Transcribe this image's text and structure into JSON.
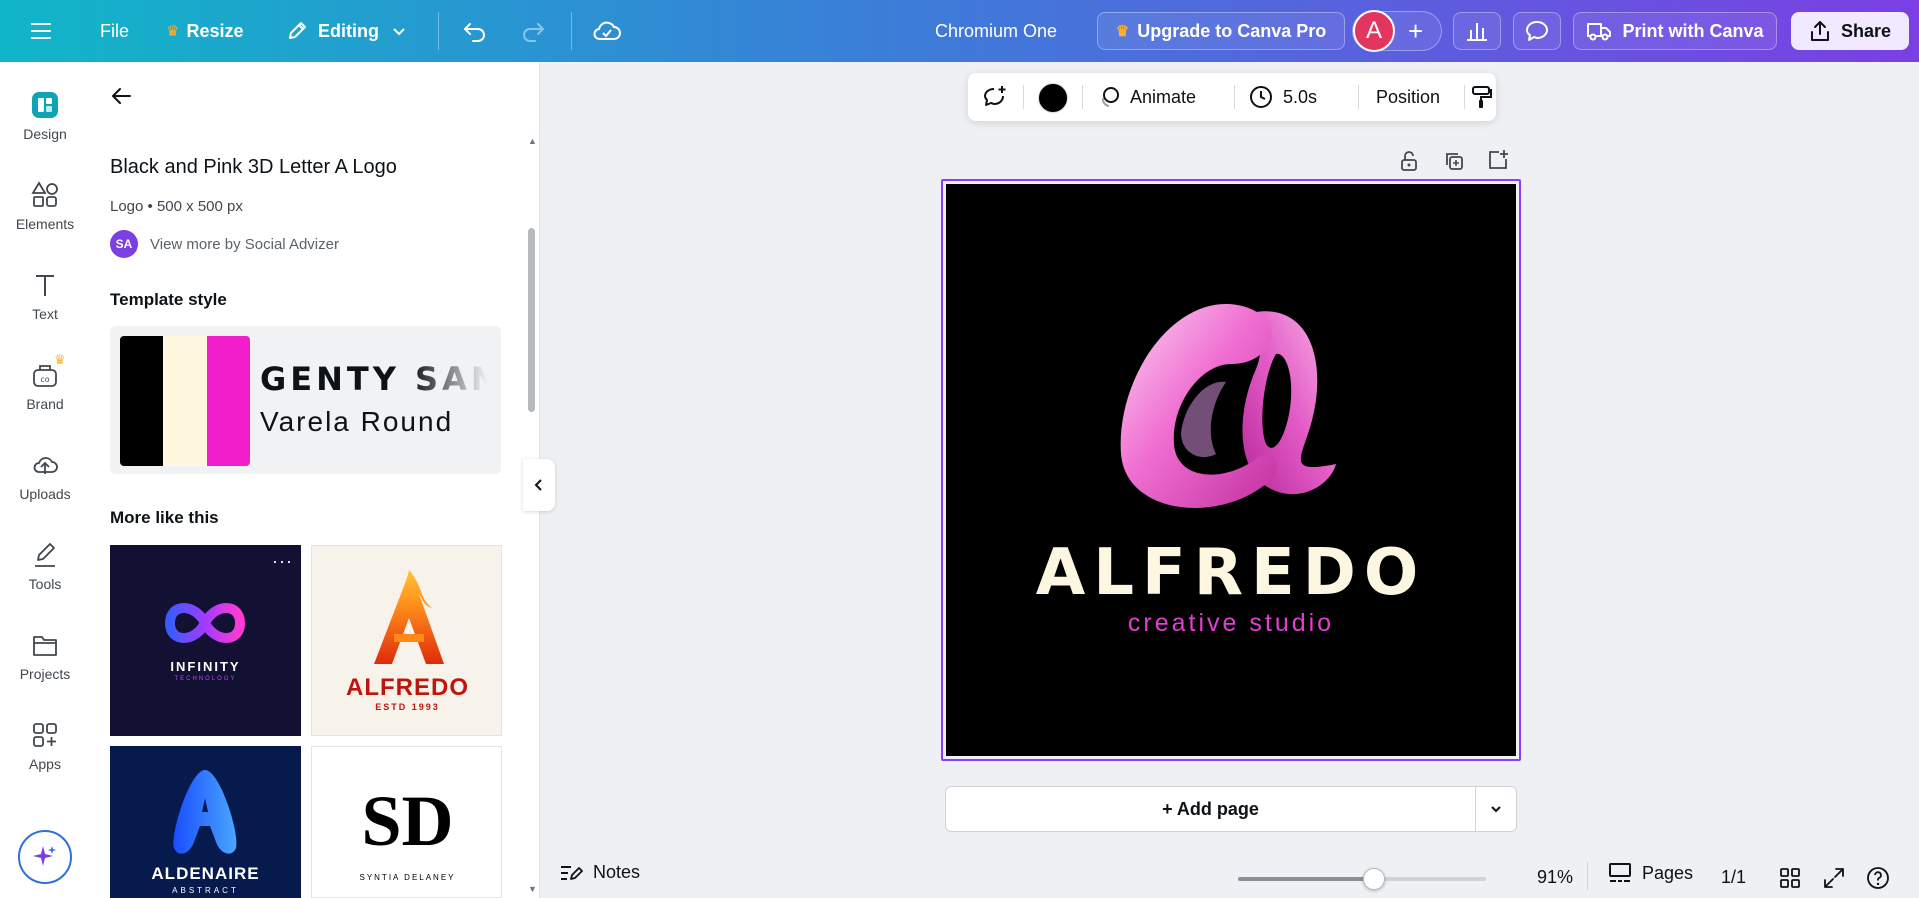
{
  "topbar": {
    "file": "File",
    "resize": "Resize",
    "editing": "Editing",
    "doc_title": "Chromium One",
    "upgrade": "Upgrade to Canva Pro",
    "avatar_initial": "A",
    "print": "Print with Canva",
    "share": "Share"
  },
  "rail": {
    "items": [
      {
        "label": "Design",
        "icon": "design-icon"
      },
      {
        "label": "Elements",
        "icon": "elements-icon"
      },
      {
        "label": "Text",
        "icon": "text-icon"
      },
      {
        "label": "Brand",
        "icon": "brand-icon"
      },
      {
        "label": "Uploads",
        "icon": "uploads-icon"
      },
      {
        "label": "Tools",
        "icon": "tools-icon"
      },
      {
        "label": "Projects",
        "icon": "projects-icon"
      },
      {
        "label": "Apps",
        "icon": "apps-icon"
      }
    ]
  },
  "panel": {
    "title": "Black and Pink 3D Letter A Logo",
    "meta": "Logo • 500 x 500 px",
    "author_initials": "SA",
    "author_link": "View more by Social Advizer",
    "template_style_heading": "Template style",
    "font_1": "GENTY SANS",
    "font_2": "Varela Round",
    "more_heading": "More like this",
    "thumbnails": [
      {
        "title": "INFINITY",
        "subtitle": "TECHNOLOGY"
      },
      {
        "title": "ALFREDO",
        "subtitle": "ESTD 1993"
      },
      {
        "title": "ALDENAIRE",
        "subtitle": "ABSTRACT"
      },
      {
        "title": "SD",
        "subtitle": "SYNTIA DELANEY"
      }
    ],
    "palette": [
      "#000000",
      "#fff7e0",
      "#f21dcb"
    ]
  },
  "canvas_toolbar": {
    "animate": "Animate",
    "duration": "5.0s",
    "position": "Position"
  },
  "design": {
    "brand": "ALFREDO",
    "tagline": "creative studio",
    "background": "#000000",
    "brand_color": "#fdf6e0",
    "tagline_color": "#e03fd0"
  },
  "add_page": "+ Add page",
  "footer": {
    "notes": "Notes",
    "zoom": "91%",
    "zoom_level": 0.55,
    "pages": "Pages",
    "page_count": "1/1"
  },
  "colors": {
    "accent": "#8b3dff",
    "selection": "#8b3dff",
    "avatar": "#e3355f"
  }
}
